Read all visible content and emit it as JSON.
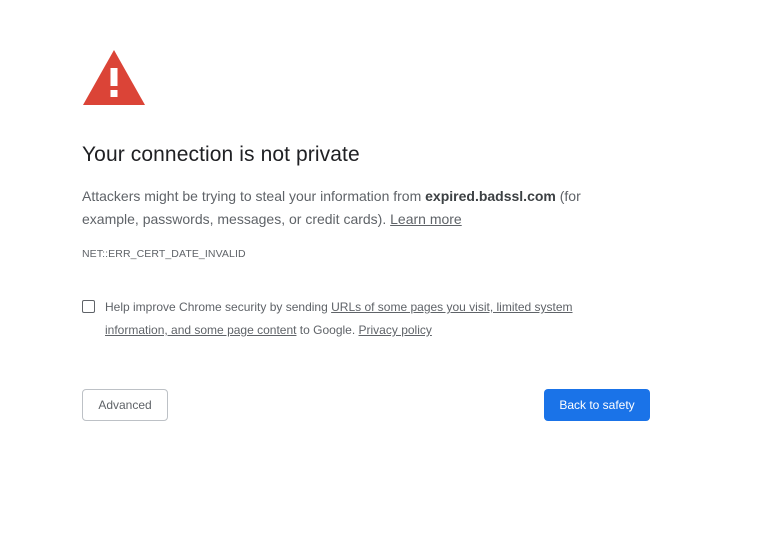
{
  "icon": {
    "name": "warning-triangle-icon",
    "color": "#db4437"
  },
  "heading": {
    "title": "Your connection is not private"
  },
  "explanation": {
    "before_domain": "Attackers might be trying to steal your information from ",
    "domain": "expired.badssl.com",
    "after_domain": " (for example, passwords, messages, or credit cards). ",
    "learn_more": "Learn more"
  },
  "error_code": "NET::ERR_CERT_DATE_INVALID",
  "checkbox": {
    "checked": false,
    "text_before": "Help improve Chrome security by sending ",
    "link_text": "URLs of some pages you visit, limited system information, and some page content",
    "text_after": " to Google. ",
    "privacy_link": "Privacy policy"
  },
  "buttons": {
    "advanced": "Advanced",
    "back_to_safety": "Back to safety"
  },
  "colors": {
    "accent": "#1a73e8",
    "text": "#5f6368",
    "title": "#202124"
  }
}
